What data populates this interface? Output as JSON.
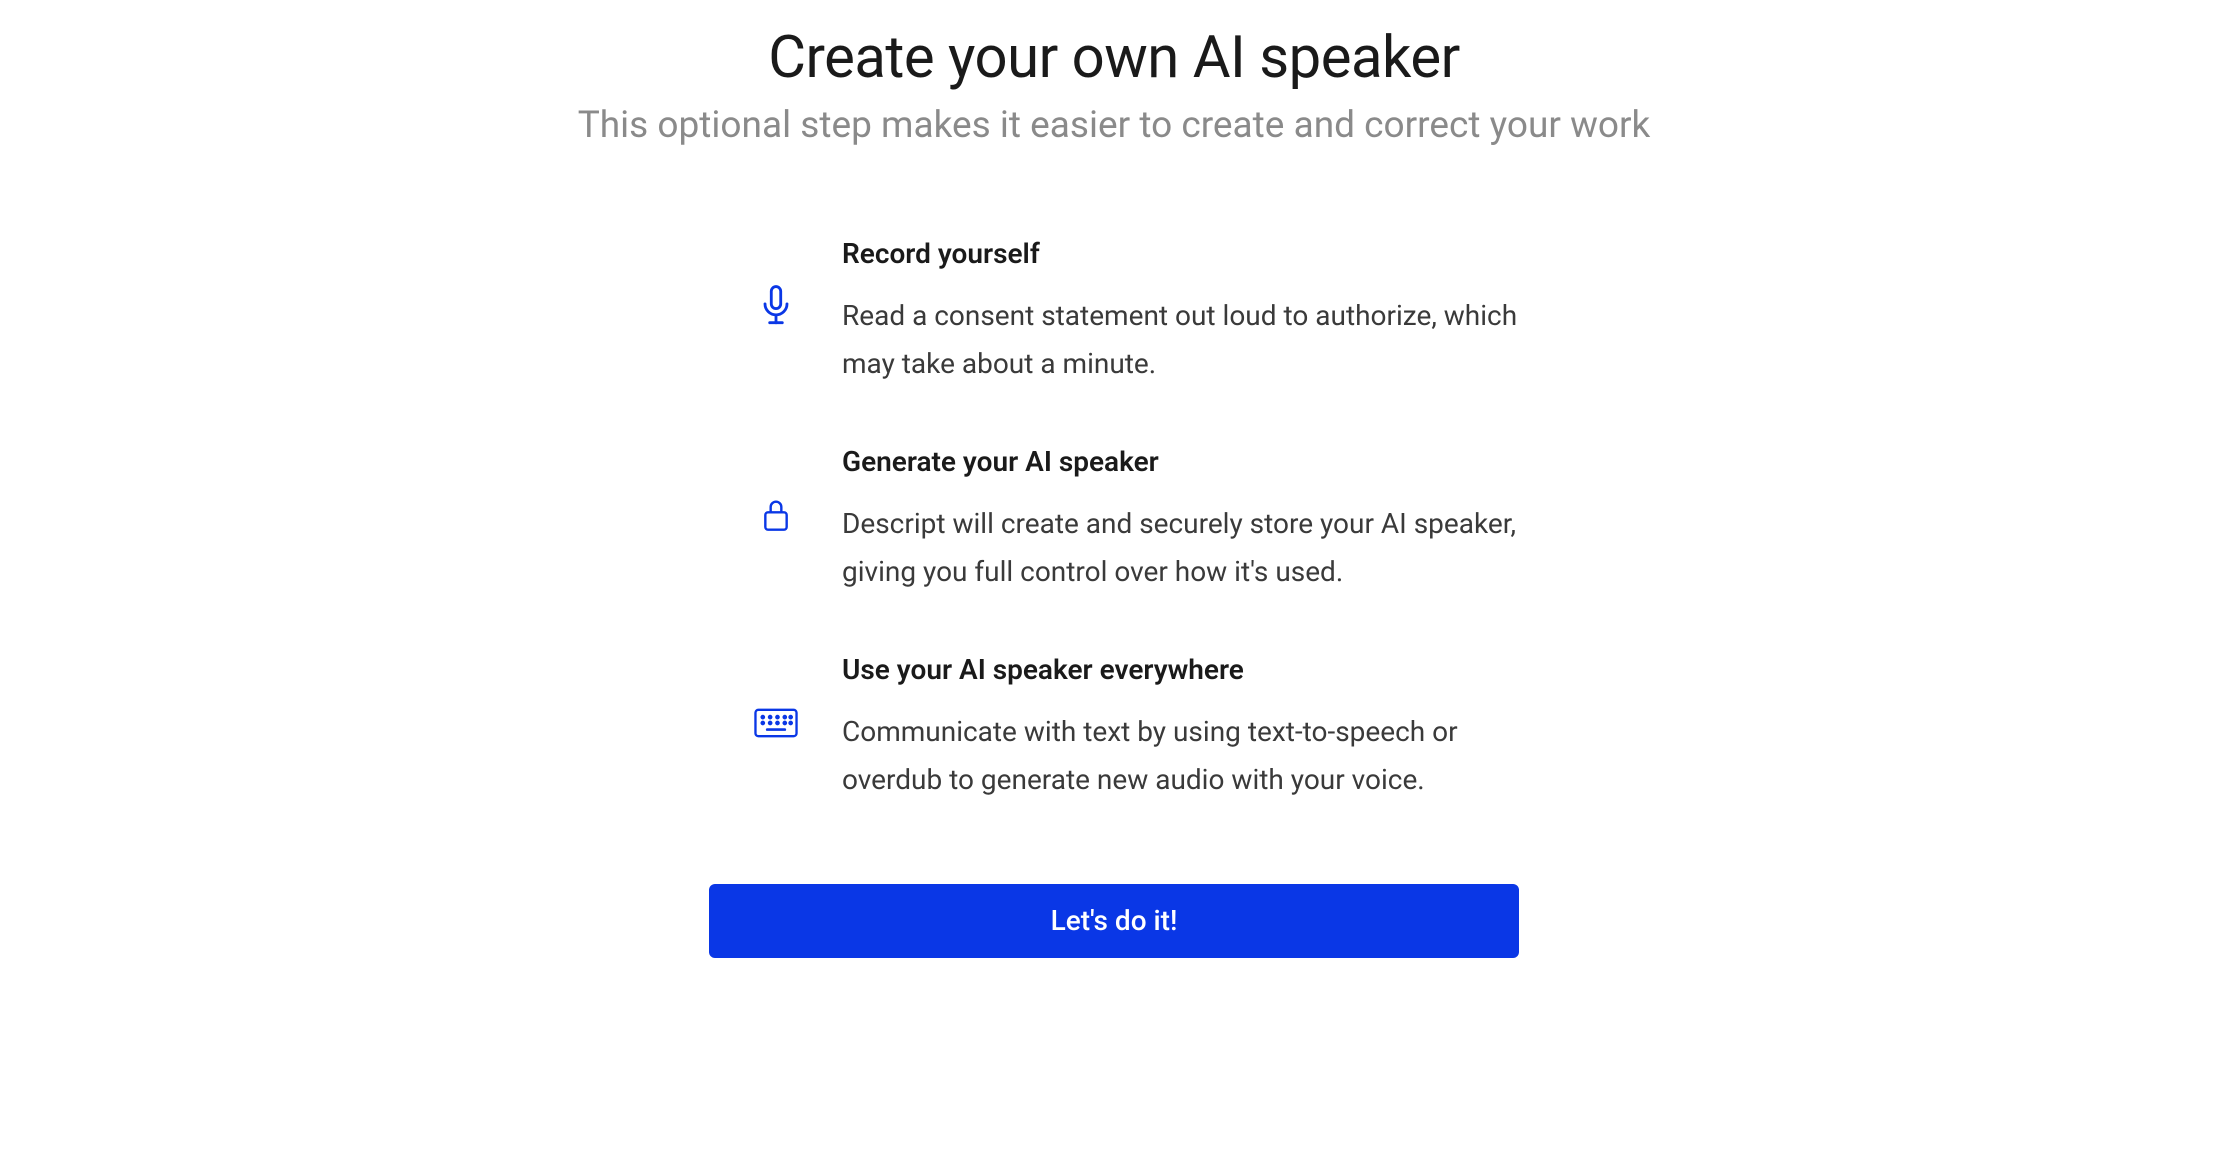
{
  "header": {
    "title": "Create your own AI speaker",
    "subtitle": "This optional step makes it easier to create and correct your work"
  },
  "steps": [
    {
      "icon": "microphone-icon",
      "title": "Record yourself",
      "description": "Read a consent statement out loud to authorize, which may take about a minute."
    },
    {
      "icon": "lock-icon",
      "title": "Generate your AI speaker",
      "description": "Descript will create and securely store your AI speaker, giving you full control over how it's used."
    },
    {
      "icon": "keyboard-icon",
      "title": "Use your AI speaker everywhere",
      "description": "Communicate with text by using text-to-speech or overdub to generate new audio with your voice."
    }
  ],
  "cta": {
    "label": "Let's do it!"
  },
  "colors": {
    "accent": "#0a37e6"
  }
}
